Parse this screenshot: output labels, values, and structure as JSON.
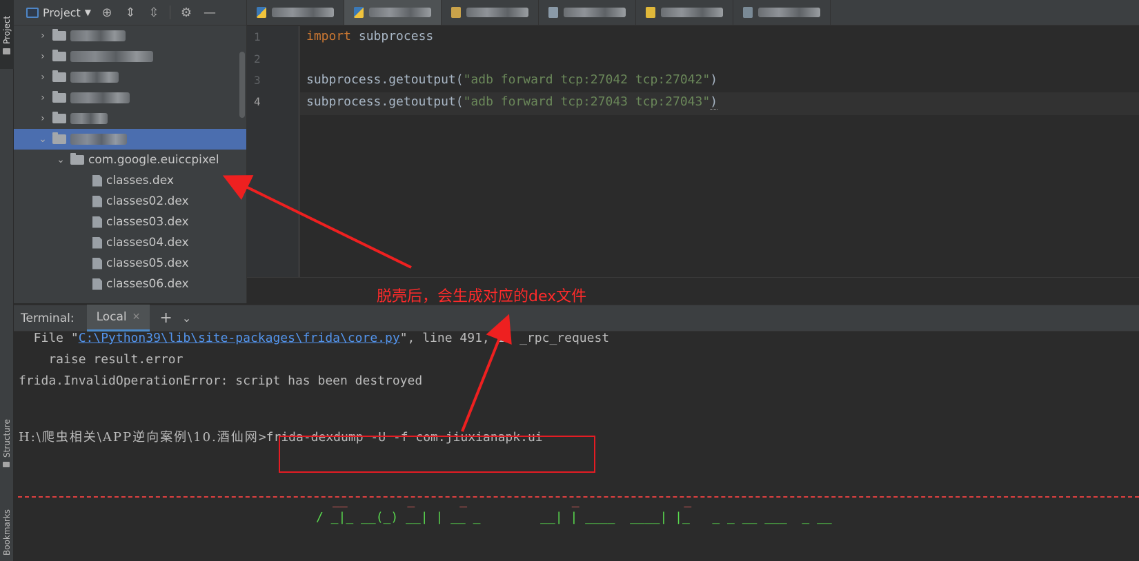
{
  "sidebar": {
    "project_tab": "Project",
    "structure_tab": "Structure",
    "bookmarks_tab": "Bookmarks"
  },
  "project_panel": {
    "title": "Project",
    "selected_package": "com.google.euiccpixel",
    "files": [
      "classes.dex",
      "classes02.dex",
      "classes03.dex",
      "classes04.dex",
      "classes05.dex",
      "classes06.dex"
    ]
  },
  "editor": {
    "line_numbers": [
      "1",
      "2",
      "3",
      "4"
    ],
    "line1_keyword": "import",
    "line1_module": " subprocess",
    "line3_call": "subprocess.getoutput(",
    "line3_string": "\"adb forward tcp:27042 tcp:27042\"",
    "line3_close": ")",
    "line4_call": "subprocess.getoutput(",
    "line4_string": "\"adb forward tcp:27043 tcp:27043\"",
    "line4_close": ")"
  },
  "annotation": {
    "text": "脱壳后，会生成对应的dex文件",
    "color": "#ff2a2a"
  },
  "terminal": {
    "label": "Terminal:",
    "tab": "Local",
    "line1_prefix": "  File \"",
    "line1_link": "C:\\Python39\\lib\\site-packages\\frida\\core.py",
    "line1_suffix": "\", line 491, in _rpc_request",
    "line2": "    raise result.error",
    "line3": "frida.InvalidOperationError: script has been destroyed",
    "prompt_path": "H:\\爬虫相关\\APP逆向案例\\10.酒仙网",
    "command": ">frida-dexdump -U -f com.jiuxianapk.ui",
    "ascii_row1": "__        _      _              _              _",
    "ascii_row2": "/ _|_ __(_) __| | __ _        __| | ____  ____| |_   _ _ __ ___  _ __"
  }
}
